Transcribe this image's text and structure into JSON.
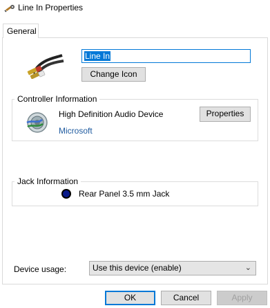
{
  "window": {
    "title": "Line In Properties"
  },
  "tabs": [
    {
      "label": "General"
    }
  ],
  "device": {
    "name_value": "Line In",
    "change_icon_label": "Change Icon"
  },
  "controller": {
    "legend": "Controller Information",
    "device_name": "High Definition Audio Device",
    "vendor": "Microsoft",
    "properties_label": "Properties"
  },
  "jack": {
    "legend": "Jack Information",
    "jack_color": "#0a1a8a",
    "description": "Rear Panel 3.5 mm Jack"
  },
  "usage": {
    "label": "Device usage:",
    "selected": "Use this device (enable)"
  },
  "buttons": {
    "ok": "OK",
    "cancel": "Cancel",
    "apply": "Apply"
  },
  "icons": {
    "title": "speaker-audio-icon",
    "device": "rca-cable-icon",
    "controller": "speaker-icon",
    "jack": "jack-port-icon",
    "dropdown": "chevron-down-icon"
  },
  "colors": {
    "accent": "#0078d7",
    "vendor_link": "#1e5a9f"
  }
}
